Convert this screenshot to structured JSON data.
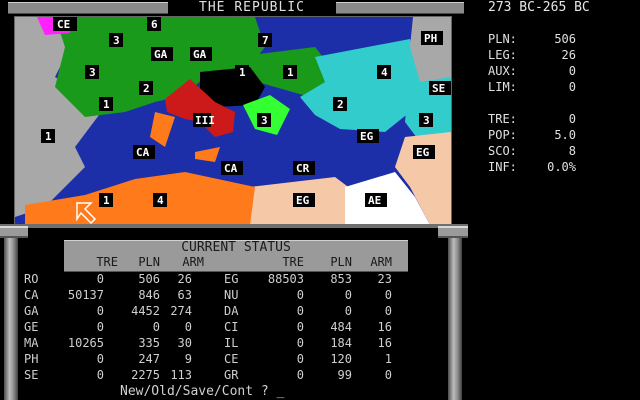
{
  "header": {
    "title": "THE REPUBLIC",
    "date_range": "273 BC-265 BC"
  },
  "map": {
    "labels": [
      {
        "id": "ce-n",
        "text": "CE"
      },
      {
        "id": "g6",
        "text": "6"
      },
      {
        "id": "g3a",
        "text": "3"
      },
      {
        "id": "ga1",
        "text": "GA"
      },
      {
        "id": "ga2",
        "text": "GA"
      },
      {
        "id": "g7",
        "text": "7"
      },
      {
        "id": "ph",
        "text": "PH"
      },
      {
        "id": "g3b",
        "text": "3"
      },
      {
        "id": "g2a",
        "text": "2"
      },
      {
        "id": "g1a",
        "text": "1"
      },
      {
        "id": "g1b",
        "text": "1"
      },
      {
        "id": "g1c",
        "text": "1"
      },
      {
        "id": "g4a",
        "text": "4"
      },
      {
        "id": "se",
        "text": "SE"
      },
      {
        "id": "g2b",
        "text": "2"
      },
      {
        "id": "g3c",
        "text": "3"
      },
      {
        "id": "g1d",
        "text": "1"
      },
      {
        "id": "ro",
        "text": "III"
      },
      {
        "id": "g3d",
        "text": "3"
      },
      {
        "id": "eg1",
        "text": "EG"
      },
      {
        "id": "eg2",
        "text": "EG"
      },
      {
        "id": "ca1",
        "text": "CA"
      },
      {
        "id": "ca2",
        "text": "CA"
      },
      {
        "id": "cr",
        "text": "CR"
      },
      {
        "id": "g1e",
        "text": "1"
      },
      {
        "id": "g4b",
        "text": "4"
      },
      {
        "id": "eg3",
        "text": "EG"
      },
      {
        "id": "ae",
        "text": "AE"
      }
    ]
  },
  "status": {
    "title": "CURRENT STATUS",
    "columns": [
      "TRE",
      "PLN",
      "ARM",
      "TRE",
      "PLN",
      "ARM"
    ],
    "left_rows": [
      {
        "code": "RO",
        "tre": "0",
        "pln": "506",
        "arm": "26"
      },
      {
        "code": "CA",
        "tre": "50137",
        "pln": "846",
        "arm": "63"
      },
      {
        "code": "GA",
        "tre": "0",
        "pln": "4452",
        "arm": "274"
      },
      {
        "code": "GE",
        "tre": "0",
        "pln": "0",
        "arm": "0"
      },
      {
        "code": "MA",
        "tre": "10265",
        "pln": "335",
        "arm": "30"
      },
      {
        "code": "PH",
        "tre": "0",
        "pln": "247",
        "arm": "9"
      },
      {
        "code": "SE",
        "tre": "0",
        "pln": "2275",
        "arm": "113"
      }
    ],
    "right_rows": [
      {
        "code": "EG",
        "tre": "88503",
        "pln": "853",
        "arm": "23"
      },
      {
        "code": "NU",
        "tre": "0",
        "pln": "0",
        "arm": "0"
      },
      {
        "code": "DA",
        "tre": "0",
        "pln": "0",
        "arm": "0"
      },
      {
        "code": "CI",
        "tre": "0",
        "pln": "484",
        "arm": "16"
      },
      {
        "code": "IL",
        "tre": "0",
        "pln": "184",
        "arm": "16"
      },
      {
        "code": "CE",
        "tre": "0",
        "pln": "120",
        "arm": "1"
      },
      {
        "code": "GR",
        "tre": "0",
        "pln": "99",
        "arm": "0"
      }
    ]
  },
  "stats": [
    {
      "label": "PLN:",
      "value": "506"
    },
    {
      "label": "LEG:",
      "value": "26"
    },
    {
      "label": "AUX:",
      "value": "0"
    },
    {
      "label": "LIM:",
      "value": "0"
    },
    {
      "label": "TRE:",
      "value": "0"
    },
    {
      "label": "POP:",
      "value": "5.0"
    },
    {
      "label": "SCO:",
      "value": "8"
    },
    {
      "label": "INF:",
      "value": "0.0%"
    }
  ],
  "prompt": "New/Old/Save/Cont ? _",
  "colors": {
    "sea": "#1c2fa8",
    "gaul": "#1a9a1a",
    "carthage": "#ff7a1a",
    "egypt": "#f5c8a8",
    "seleucid": "#33cccc",
    "rome": "#cc1a1a",
    "land": "#a8a8a8",
    "celt": "#ff22ff",
    "macedon": "#33ff33",
    "aegypt": "#ffffff"
  }
}
